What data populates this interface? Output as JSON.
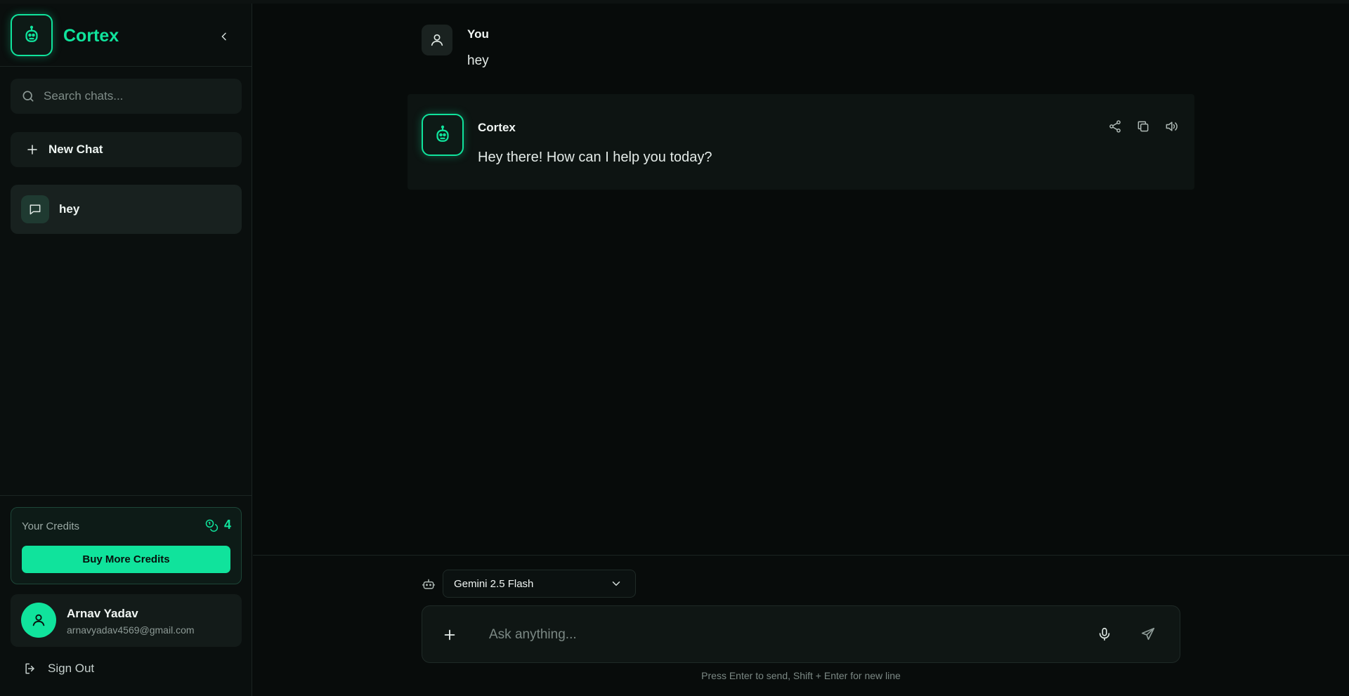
{
  "sidebar": {
    "brand": "Cortex",
    "search_placeholder": "Search chats...",
    "new_chat_label": "New Chat",
    "chats": [
      {
        "title": "hey"
      }
    ],
    "credits": {
      "title": "Your Credits",
      "count": "4",
      "buy_label": "Buy More Credits"
    },
    "user": {
      "name": "Arnav Yadav",
      "email": "arnavyadav4569@gmail.com"
    },
    "signout_label": "Sign Out"
  },
  "conversation": {
    "user_message": {
      "author": "You",
      "text": "hey"
    },
    "assistant_message": {
      "author": "Cortex",
      "text": "Hey there! How can I help you today?"
    }
  },
  "composer": {
    "model_selected": "Gemini 2.5 Flash",
    "input_value": "",
    "placeholder": "Ask anything...",
    "hint": "Press Enter to send, Shift + Enter for new line"
  },
  "icons": {
    "logo": "robot-icon",
    "collapse": "chevron-left-icon",
    "search": "search-icon",
    "new_chat": "plus-icon",
    "chat_item": "message-square-icon",
    "credits": "coins-icon",
    "avatar": "user-icon",
    "signout": "log-out-icon",
    "share": "share-icon",
    "copy": "copy-icon",
    "speak": "volume-icon",
    "model": "bot-icon",
    "attach": "plus-icon",
    "mic": "mic-icon",
    "send": "send-icon"
  },
  "colors": {
    "accent": "#10e39c",
    "background": "#070b0a",
    "panel": "#131b19"
  }
}
